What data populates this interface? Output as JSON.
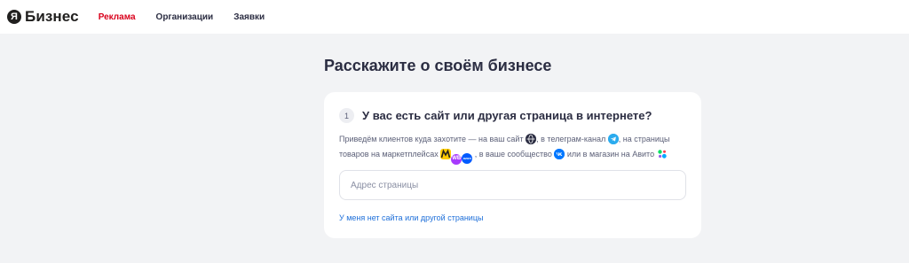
{
  "header": {
    "logo_letter": "Я",
    "logo_text": "Бизнес",
    "nav": [
      {
        "label": "Реклама",
        "active": true
      },
      {
        "label": "Организации",
        "active": false
      },
      {
        "label": "Заявки",
        "active": false
      }
    ]
  },
  "page": {
    "title": "Расскажите о своём бизнесе"
  },
  "step": {
    "number": "1",
    "question": "У вас есть сайт или другая страница в интернете?",
    "desc_parts": {
      "p1": "Приведём клиентов куда захотите — на ваш сайт",
      "p2": ", в телеграм-канал",
      "p3": ", на страницы товаров на маркетплейсах",
      "p4": ", в ваше сообщество",
      "p5": "или в магазин на Авито"
    },
    "icons": [
      "web-icon",
      "telegram-icon",
      "yandex-market-icon",
      "wildberries-icon",
      "ozon-icon",
      "vk-icon",
      "avito-icon"
    ],
    "marketplace_badges": {
      "wb": "WB",
      "ozon": "ozon"
    },
    "input_placeholder": "Адрес страницы",
    "input_value": "",
    "no_site_link": "У меня нет сайта или другой страницы"
  },
  "colors": {
    "accent_red": "#d9001b",
    "link_blue": "#1e6fd9",
    "background": "#f2f3f5"
  }
}
